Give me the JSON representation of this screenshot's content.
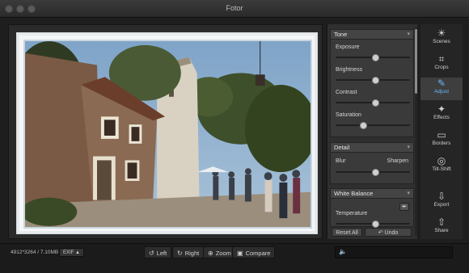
{
  "window": {
    "title": "Fotor"
  },
  "panel": {
    "tone": {
      "header": "Tone",
      "sliders": [
        {
          "label": "Exposure",
          "value": 0.54
        },
        {
          "label": "Brightness",
          "value": 0.54
        },
        {
          "label": "Contrast",
          "value": 0.54
        },
        {
          "label": "Saturation",
          "value": 0.38
        }
      ]
    },
    "detail": {
      "header": "Detail",
      "blur_label": "Blur",
      "sharpen_label": "Sharpen",
      "value": 0.54
    },
    "white_balance": {
      "header": "White Balance",
      "temperature_label": "Temperature",
      "value": 0.54
    },
    "reset_label": "Reset All",
    "undo_label": "Undo"
  },
  "tools": [
    {
      "label": "Scenes",
      "icon": "sun-icon",
      "glyph": "☀"
    },
    {
      "label": "Crops",
      "icon": "crop-icon",
      "glyph": "⌗"
    },
    {
      "label": "Adjust",
      "icon": "pencil-icon",
      "glyph": "✎",
      "active": true
    },
    {
      "label": "Effects",
      "icon": "sparkle-icon",
      "glyph": "✦"
    },
    {
      "label": "Borders",
      "icon": "frame-icon",
      "glyph": "▭"
    },
    {
      "label": "Tilt-Shift",
      "icon": "target-icon",
      "glyph": "◎"
    },
    {
      "label": "Export",
      "icon": "export-icon",
      "glyph": "⇩"
    },
    {
      "label": "Share",
      "icon": "share-icon",
      "glyph": "⇧"
    }
  ],
  "bottom": {
    "image_info": "4912*3264 / 7.10MB",
    "exif_label": "EXIF ▲",
    "left_label": "Left",
    "right_label": "Right",
    "zoom_label": "Zoom",
    "compare_label": "Compare"
  },
  "colors": {
    "accent": "#6cb6ff",
    "speaker": "#f0c419"
  }
}
